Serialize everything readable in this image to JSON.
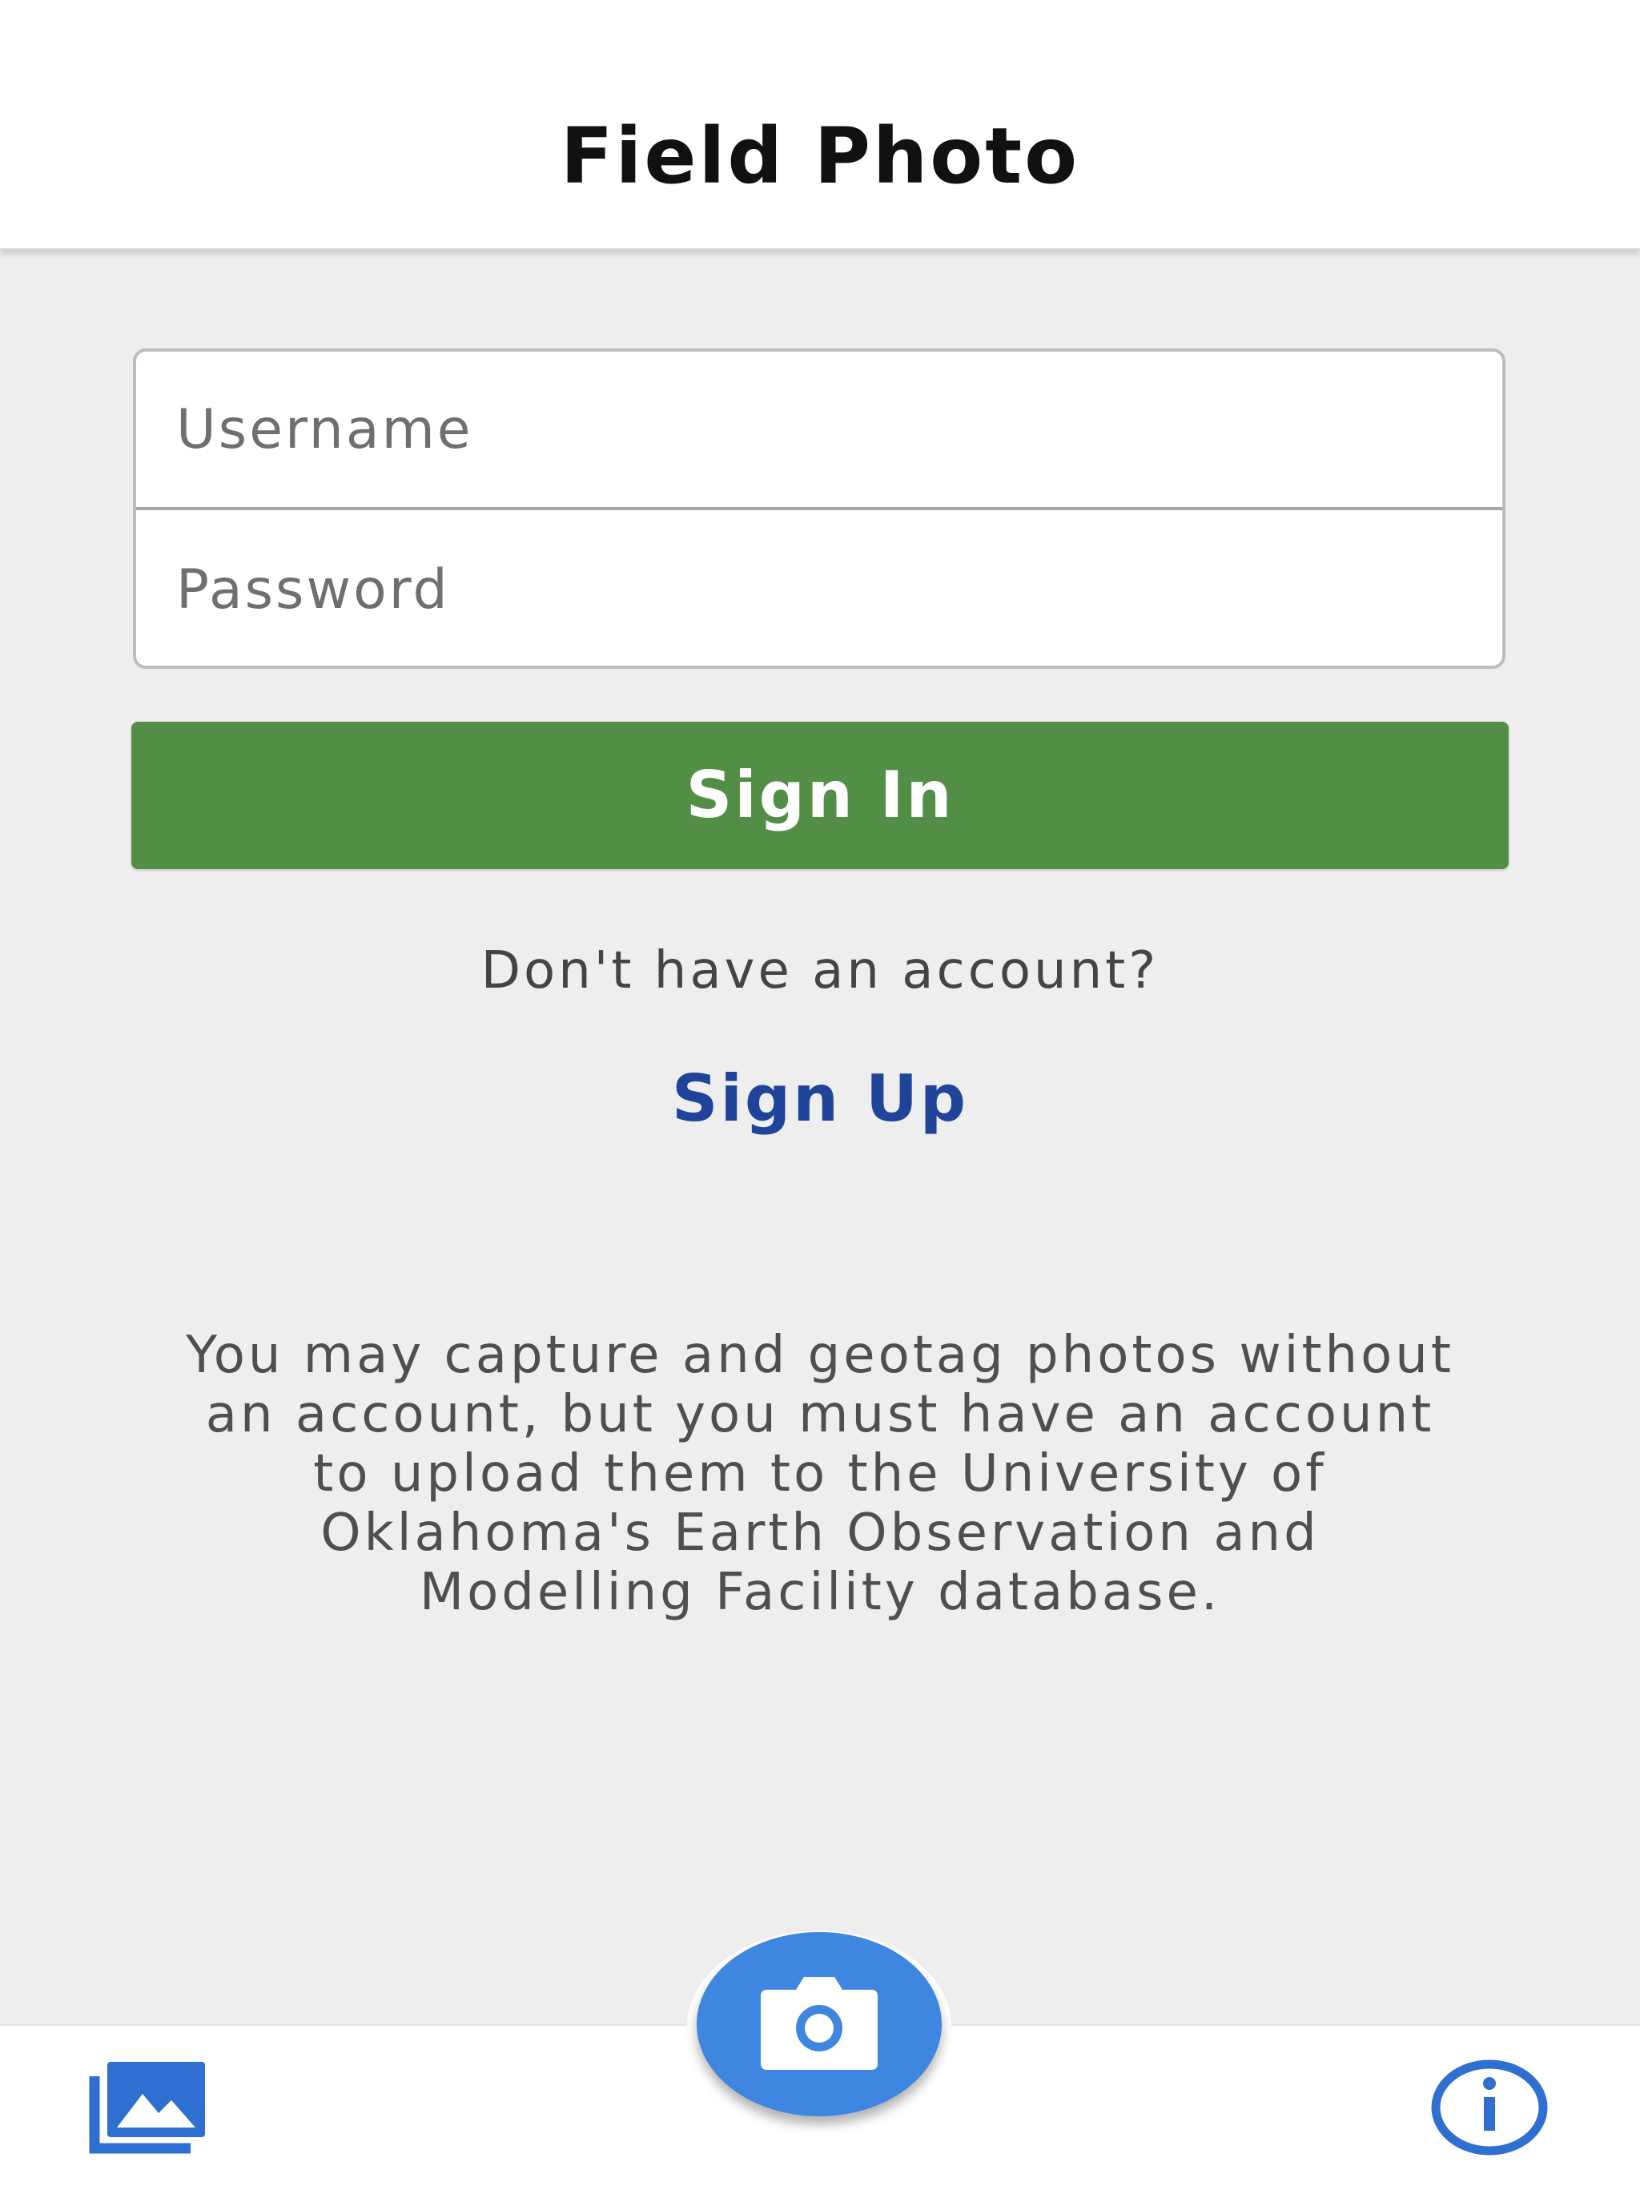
{
  "app": {
    "title": "Field Photo"
  },
  "login": {
    "username_placeholder": "Username",
    "password_placeholder": "Password",
    "sign_in_label": "Sign In",
    "no_account_text": "Don't have an account?",
    "sign_up_label": "Sign Up"
  },
  "info": {
    "line1": "You may capture and geotag photos without",
    "line2": "an account, but you must have an account",
    "line3": "to upload them to the University of",
    "line4": "Oklahoma's Earth Observation and",
    "line5": "Modelling Facility database."
  },
  "bottom_nav": {
    "left_icon": "photo-library-icon",
    "center_icon": "camera-icon",
    "right_icon": "info-icon"
  },
  "colors": {
    "background": "#eeeeef",
    "primary_green": "#528e46",
    "link_blue": "#1f449a",
    "accent_blue": "#3f86e0"
  }
}
